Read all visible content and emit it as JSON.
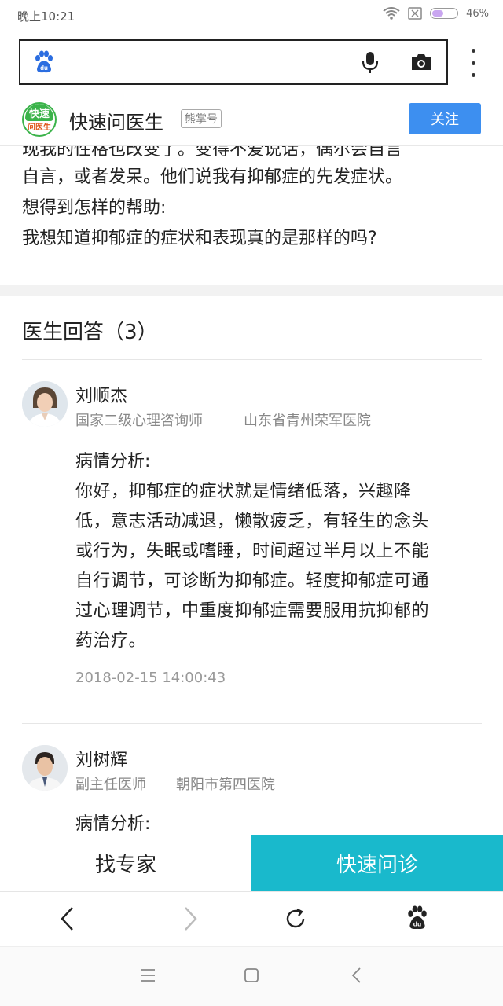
{
  "status_bar": {
    "time": "晚上10:21",
    "battery_percent": "46%",
    "battery_level": 0.46
  },
  "account": {
    "logo_top": "快速",
    "logo_bottom": "问医生",
    "name": "快速问医生",
    "badge": "熊掌号",
    "follow_label": "关注"
  },
  "question": {
    "clipped_line": "现我的性格也改变了。变得不爱说话，偶尔会自言",
    "lines": [
      "自言，或者发呆。他们说我有抑郁症的先发症状。",
      "想得到怎样的帮助:",
      "我想知道抑郁症的症状和表现真的是那样的吗?"
    ]
  },
  "answers_header": "医生回答（3）",
  "doctors": [
    {
      "name": "刘顺杰",
      "title": "国家二级心理咨询师",
      "hospital": "山东省青州荣军医院",
      "analysis_label": "病情分析:",
      "lines": [
        "你好，抑郁症的症状就是情绪低落，兴趣降",
        "低，意志活动减退，懒散疲乏，有轻生的念头",
        "或行为，失眠或嗜睡，时间超过半月以上不能",
        "自行调节，可诊断为抑郁症。轻度抑郁症可通",
        "过心理调节，中重度抑郁症需要服用抗抑郁的",
        "药治疗。"
      ],
      "time": "2018-02-15 14:00:43"
    },
    {
      "name": "刘树辉",
      "title": "副主任医师",
      "hospital": "朝阳市第四医院",
      "analysis_label": "病情分析:"
    }
  ],
  "actions": {
    "find_expert": "找专家",
    "quick_consult": "快速问诊"
  },
  "colors": {
    "accent_blue": "#3d8ff0",
    "consult_teal": "#19b9cc",
    "logo_green": "#3bb34a"
  }
}
